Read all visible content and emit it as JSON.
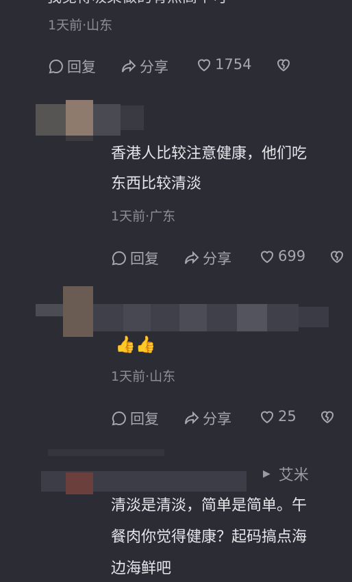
{
  "comments": [
    {
      "text_lines": [
        "我觉得吸菜做的有点高个可"
      ],
      "meta": "1天前·山东",
      "actions": {
        "reply": "回复",
        "share": "分享",
        "likes": "1754"
      }
    },
    {
      "text_lines": [
        "香港人比较注意健康，他们吃",
        "东西比较清淡"
      ],
      "meta": "1天前·广东",
      "actions": {
        "reply": "回复",
        "share": "分享",
        "likes": "699"
      }
    },
    {
      "text_lines": [
        "👍👍"
      ],
      "meta": "1天前·山东",
      "actions": {
        "reply": "回复",
        "share": "分享",
        "likes": "25"
      }
    },
    {
      "reply_to": "艾米",
      "text_lines": [
        "清淡是清淡，简单是简单。午",
        "餐肉你觉得健康？起码搞点海",
        "边海鲜吧"
      ]
    }
  ],
  "colors": {
    "background": "#2b2c34",
    "meta": "#8e8f96",
    "text": "#e6e6ea"
  }
}
